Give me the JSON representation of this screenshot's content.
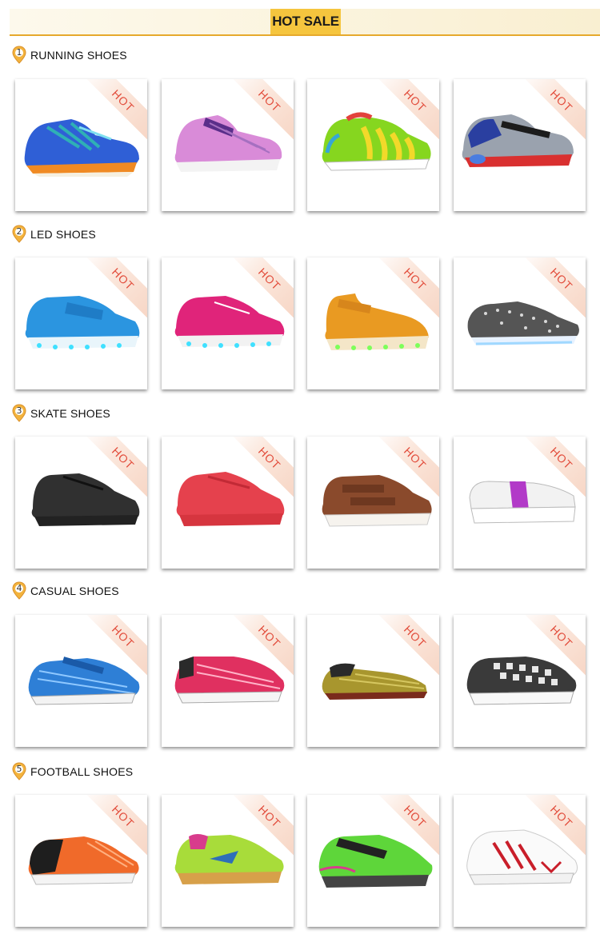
{
  "banner": {
    "title": "HOT SALE"
  },
  "badge": "HOT",
  "sections": [
    {
      "number": "1",
      "title": "RUNNING SHOES"
    },
    {
      "number": "2",
      "title": "LED SHOES"
    },
    {
      "number": "3",
      "title": "SKATE SHOES"
    },
    {
      "number": "4",
      "title": "CASUAL SHOES"
    },
    {
      "number": "5",
      "title": "FOOTBALL SHOES"
    }
  ],
  "colors": {
    "accent": "#f5c53e",
    "hot_text": "#e24d3c",
    "underline": "#e6a92c"
  }
}
